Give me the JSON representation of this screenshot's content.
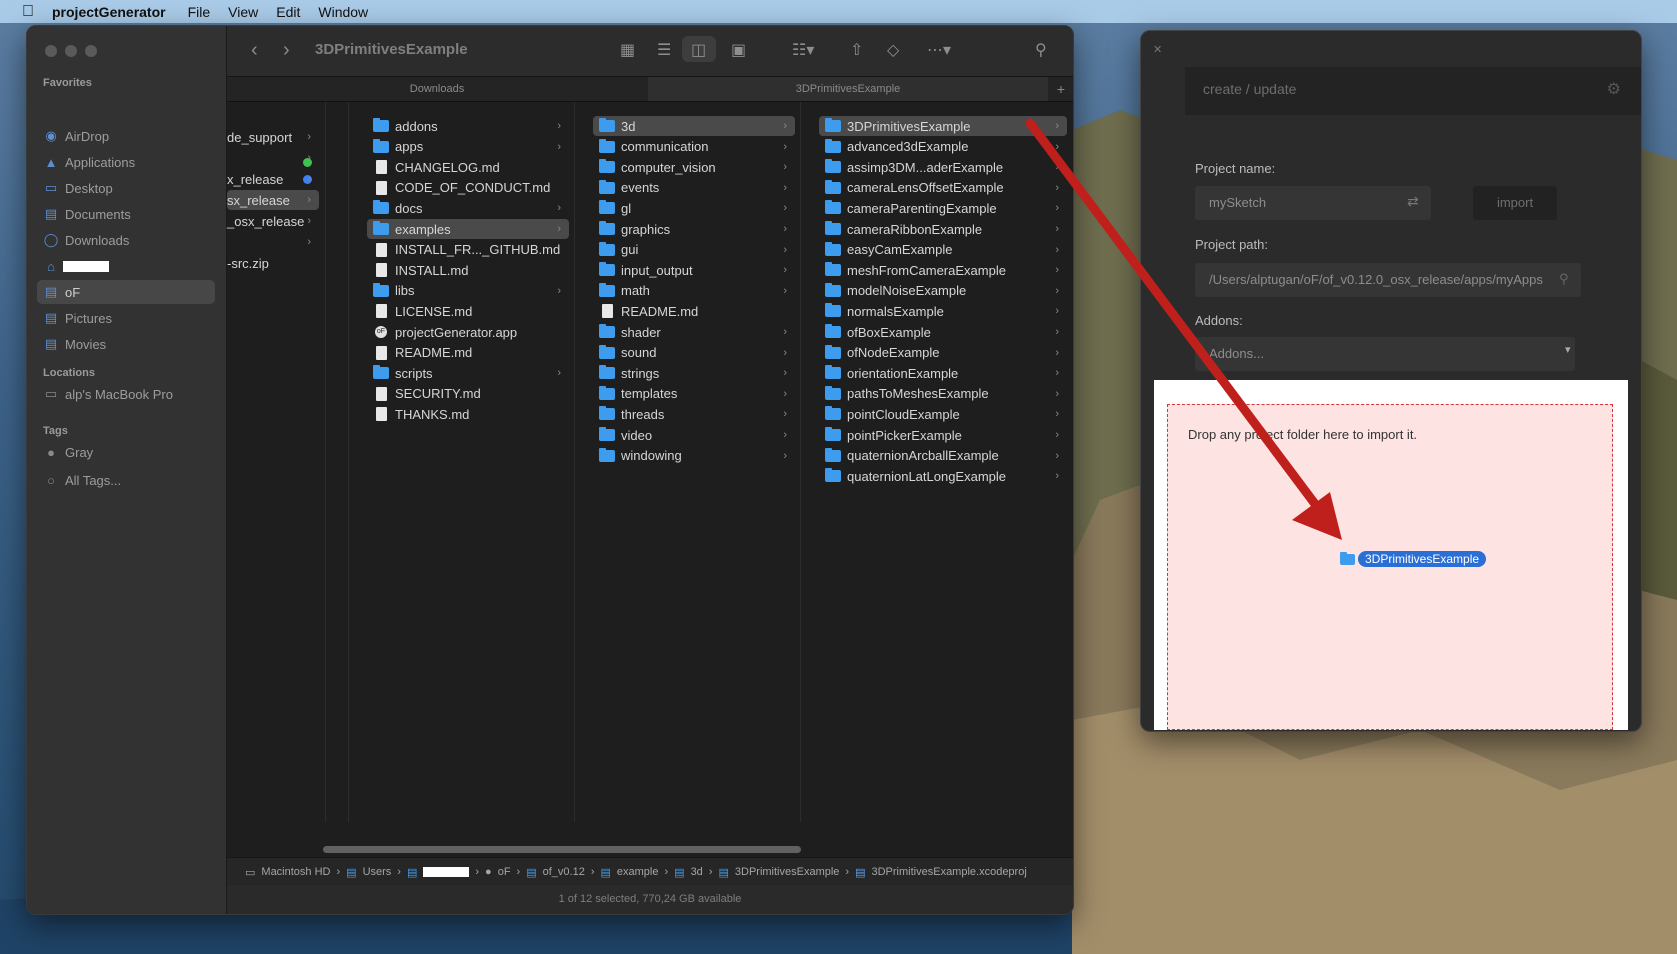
{
  "menubar": {
    "app_name": "projectGenerator",
    "items": [
      "File",
      "View",
      "Edit",
      "Window"
    ]
  },
  "finder": {
    "title": "3DPrimitivesExample",
    "tabs": [
      "Downloads",
      "3DPrimitivesExample"
    ],
    "sidebar": {
      "favorites_heading": "Favorites",
      "favorites": [
        {
          "label": "AirDrop",
          "icon": "airdrop-icon"
        },
        {
          "label": "Applications",
          "icon": "applications-icon"
        },
        {
          "label": "Desktop",
          "icon": "desktop-icon"
        },
        {
          "label": "Documents",
          "icon": "documents-icon"
        },
        {
          "label": "Downloads",
          "icon": "downloads-icon"
        },
        {
          "label": "",
          "icon": "home-icon"
        },
        {
          "label": "oF",
          "icon": "folder-icon"
        },
        {
          "label": "Pictures",
          "icon": "pictures-icon"
        },
        {
          "label": "Movies",
          "icon": "movies-icon"
        }
      ],
      "locations_heading": "Locations",
      "locations": [
        {
          "label": "alp's MacBook Pro",
          "icon": "laptop-icon"
        }
      ],
      "tags_heading": "Tags",
      "tags": [
        {
          "label": "Gray"
        },
        {
          "label": "All Tags..."
        }
      ]
    },
    "col1": [
      "de_support",
      "",
      "x_release",
      "sx_release",
      "_osx_release",
      "",
      "-src.zip"
    ],
    "col2": [
      {
        "name": "addons",
        "type": "folder"
      },
      {
        "name": "apps",
        "type": "folder"
      },
      {
        "name": "CHANGELOG.md",
        "type": "doc"
      },
      {
        "name": "CODE_OF_CONDUCT.md",
        "type": "doc"
      },
      {
        "name": "docs",
        "type": "folder"
      },
      {
        "name": "examples",
        "type": "folder"
      },
      {
        "name": "INSTALL_FR..._GITHUB.md",
        "type": "doc"
      },
      {
        "name": "INSTALL.md",
        "type": "doc"
      },
      {
        "name": "libs",
        "type": "folder"
      },
      {
        "name": "LICENSE.md",
        "type": "doc"
      },
      {
        "name": "projectGenerator.app",
        "type": "app"
      },
      {
        "name": "README.md",
        "type": "doc"
      },
      {
        "name": "scripts",
        "type": "folder"
      },
      {
        "name": "SECURITY.md",
        "type": "doc"
      },
      {
        "name": "THANKS.md",
        "type": "doc"
      }
    ],
    "col3": [
      {
        "name": "3d",
        "type": "folder"
      },
      {
        "name": "communication",
        "type": "folder"
      },
      {
        "name": "computer_vision",
        "type": "folder"
      },
      {
        "name": "events",
        "type": "folder"
      },
      {
        "name": "gl",
        "type": "folder"
      },
      {
        "name": "graphics",
        "type": "folder"
      },
      {
        "name": "gui",
        "type": "folder"
      },
      {
        "name": "input_output",
        "type": "folder"
      },
      {
        "name": "math",
        "type": "folder"
      },
      {
        "name": "README.md",
        "type": "doc"
      },
      {
        "name": "shader",
        "type": "folder"
      },
      {
        "name": "sound",
        "type": "folder"
      },
      {
        "name": "strings",
        "type": "folder"
      },
      {
        "name": "templates",
        "type": "folder"
      },
      {
        "name": "threads",
        "type": "folder"
      },
      {
        "name": "video",
        "type": "folder"
      },
      {
        "name": "windowing",
        "type": "folder"
      }
    ],
    "col4": [
      "3DPrimitivesExample",
      "advanced3dExample",
      "assimp3DM...aderExample",
      "cameraLensOffsetExample",
      "cameraParentingExample",
      "cameraRibbonExample",
      "easyCamExample",
      "meshFromCameraExample",
      "modelNoiseExample",
      "normalsExample",
      "ofBoxExample",
      "ofNodeExample",
      "orientationExample",
      "pathsToMeshesExample",
      "pointCloudExample",
      "pointPickerExample",
      "quaternionArcballExample",
      "quaternionLatLongExample"
    ],
    "pathbar": [
      "Macintosh HD",
      "Users",
      "",
      "oF",
      "of_v0.12",
      "example",
      "3d",
      "3DPrimitivesExample",
      "3DPrimitivesExample.xcodeproj"
    ],
    "status": "1 of 12 selected, 770,24 GB available"
  },
  "pg": {
    "header": "create / update",
    "project_name_label": "Project name:",
    "project_name_value": "mySketch",
    "import_label": "import",
    "project_path_label": "Project path:",
    "project_path_value": "/Users/alptugan/oF/of_v0.12.0_osx_release/apps/myApps",
    "addons_label": "Addons:",
    "addons_placeholder": "Addons...",
    "drop_text": "Drop any project folder here to import it.",
    "drag_item": "3DPrimitivesExample"
  },
  "colors": {
    "accent": "#3e9cef",
    "arrow": "#c0201c",
    "drop_bg": "#fde3e1",
    "drop_border": "#d8353a"
  }
}
